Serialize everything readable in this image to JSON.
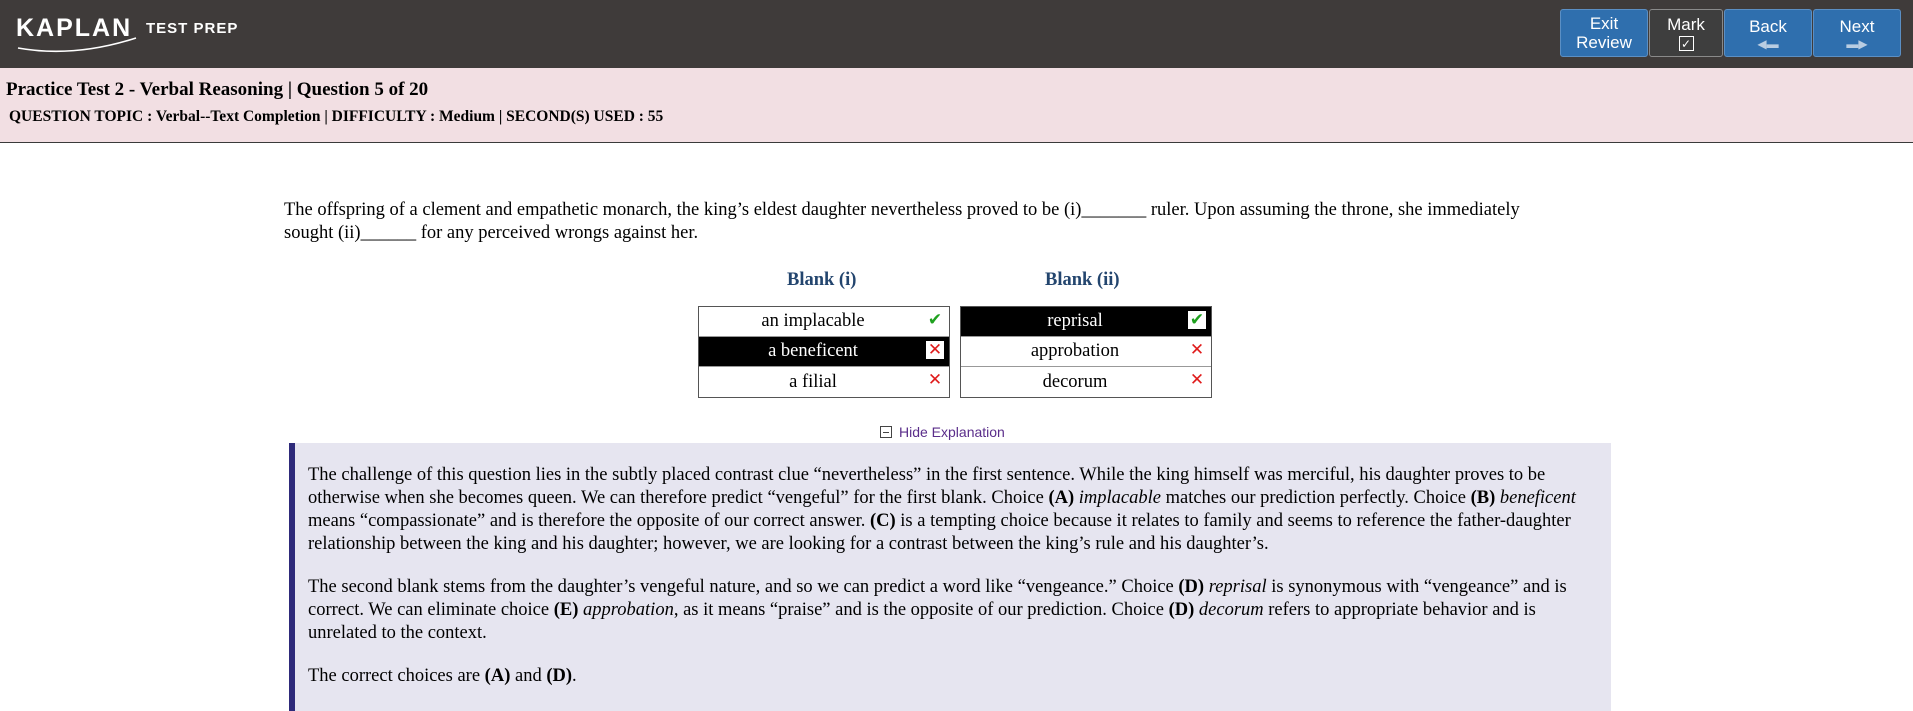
{
  "header": {
    "logo_text": "KAPLAN",
    "logo_sub": "TEST PREP",
    "buttons": [
      {
        "line1": "Exit",
        "line2": "Review"
      },
      {
        "line1": "Mark",
        "icon": "checkbox-checked-icon"
      },
      {
        "line1": "Back",
        "icon": "arrow-left-icon"
      },
      {
        "line1": "Next",
        "icon": "arrow-right-icon"
      }
    ]
  },
  "info": {
    "title": "Practice Test 2 - Verbal Reasoning | Question 5 of 20",
    "meta": "QUESTION TOPIC : Verbal--Text Completion | DIFFICULTY : Medium | SECOND(S) USED : 55"
  },
  "question": {
    "line1": "The offspring of a clement and empathetic monarch, the king’s eldest daughter nevertheless proved to be (i)_______ ruler. Upon assuming the throne, she immediately",
    "line2": "sought (ii)______ for any perceived wrongs against her."
  },
  "blank1": {
    "heading": "Blank (i)",
    "options": [
      {
        "label": "an implacable",
        "status": "correct",
        "selected": false
      },
      {
        "label": "a beneficent",
        "status": "incorrect",
        "selected": true
      },
      {
        "label": "a filial",
        "status": "incorrect",
        "selected": false
      }
    ]
  },
  "blank2": {
    "heading": "Blank (ii)",
    "options": [
      {
        "label": "reprisal",
        "status": "correct",
        "selected": true
      },
      {
        "label": "approbation",
        "status": "incorrect",
        "selected": false
      },
      {
        "label": "decorum",
        "status": "incorrect",
        "selected": false
      }
    ]
  },
  "explanation": {
    "toggle_label": "Hide Explanation",
    "p1": {
      "t1": "The challenge of this question lies in the subtly placed contrast clue “nevertheless” in the first sentence. While the king himself was merciful, his daughter proves to be otherwise when she becomes queen. We can therefore predict “vengeful” for the first blank. Choice ",
      "b1": "(A)",
      "i1": "implacable",
      "t2": " matches our prediction perfectly. Choice ",
      "b2": "(B)",
      "i2": "beneficent",
      "t3": " means “compassionate” and is therefore the opposite of our correct answer. ",
      "b3": "(C)",
      "t4": " is a tempting choice because it relates to family and seems to reference the father-daughter relationship between the king and his daughter; however, we are looking for a contrast between the king’s rule and his daughter’s."
    },
    "p2": {
      "t1": "The second blank stems from the daughter’s vengeful nature, and so we can predict a word like “vengeance.” Choice ",
      "b1": "(D)",
      "i1": "reprisal",
      "t2": " is synonymous with “vengeance” and is correct. We can eliminate choice ",
      "b2": "(E)",
      "i2": "approbation",
      "t3": ", as it means “praise” and is the opposite of our prediction. Choice ",
      "b3": "(D)",
      "i3": "decorum",
      "t4": " refers to appropriate behavior and is unrelated to the context."
    },
    "p3": {
      "t1": "The correct choices are ",
      "b1": "(A)",
      "t2": " and ",
      "b2": "(D)",
      "t3": "."
    }
  },
  "colors": {
    "topbar": "#3f3b3a",
    "button": "#2f6fae",
    "info_band": "#f2dfe3",
    "explanation_bg": "#e6e5f0",
    "explanation_border": "#2e2a7a",
    "correct": "#1fa11f",
    "incorrect": "#e01b1b"
  }
}
